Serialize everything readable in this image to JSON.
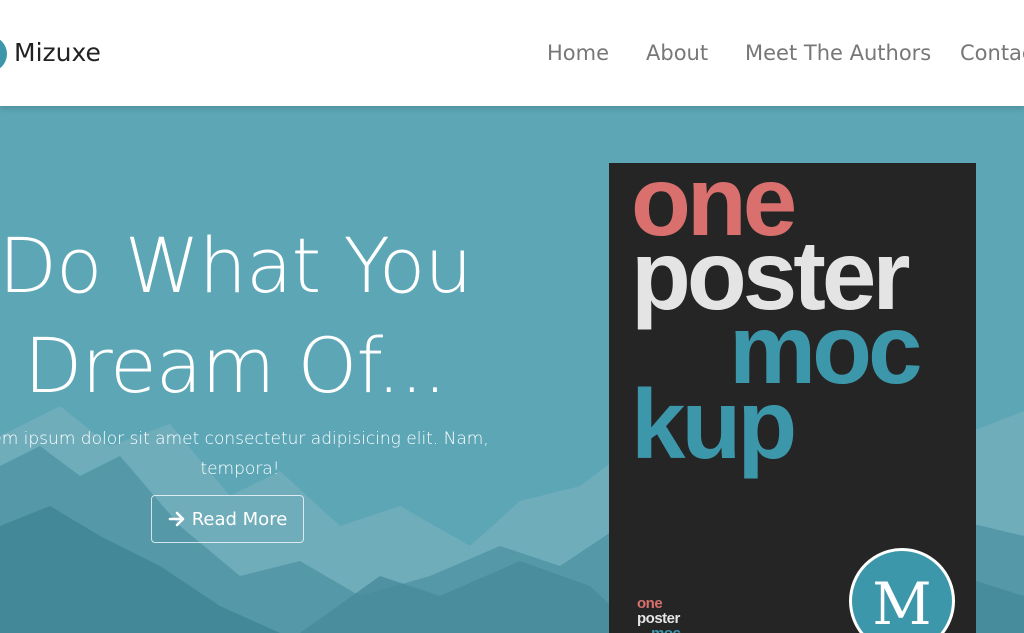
{
  "brand": {
    "name": "Mizuxe",
    "logo_icon": "circle-logo-icon"
  },
  "nav": {
    "items": [
      {
        "label": "Home"
      },
      {
        "label": "About"
      },
      {
        "label": "Meet The Authors"
      },
      {
        "label": "Contac"
      }
    ]
  },
  "hero": {
    "title_line1": "Do What You",
    "title_line2": "Dream Of...",
    "text_line1": "em ipsum dolor sit amet consectetur adipisicing elit. Nam,",
    "text_line2": "tempora!",
    "button_label": "Read More",
    "button_icon": "arrow-right-icon"
  },
  "poster": {
    "word1": "one",
    "word2": "poster",
    "word3": "moc",
    "word4": "kup",
    "mini1": "one",
    "mini2": "poster",
    "mini3": "moc",
    "badge_letter": "M"
  },
  "colors": {
    "accent": "#3d97ab",
    "coral": "#d9706e",
    "hero_bg": "#5ca6b6",
    "poster_bg": "#252525"
  }
}
